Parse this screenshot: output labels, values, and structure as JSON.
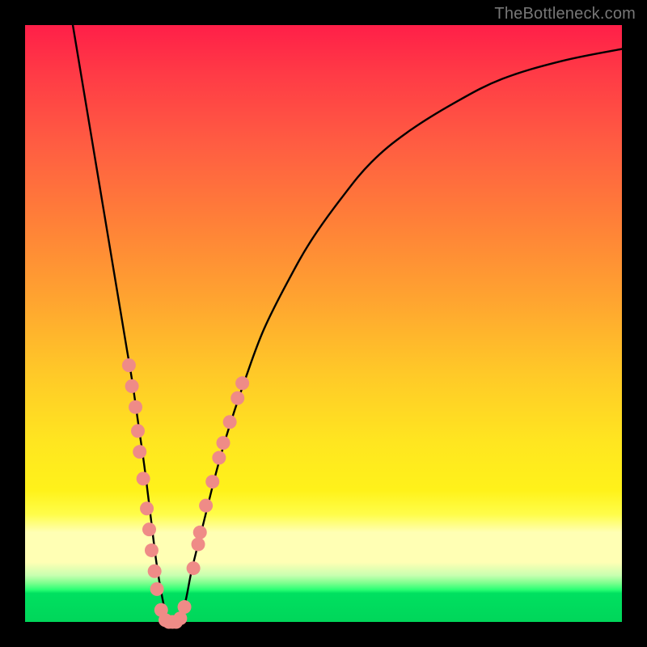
{
  "watermark": "TheBottleneck.com",
  "chart_data": {
    "type": "line",
    "title": "",
    "xlabel": "",
    "ylabel": "",
    "xlim": [
      0,
      100
    ],
    "ylim": [
      0,
      100
    ],
    "series": [
      {
        "name": "bottleneck-curve",
        "x": [
          8,
          10,
          12,
          14,
          16,
          17,
          18,
          19,
          20,
          21,
          22,
          23,
          24,
          25,
          26,
          27,
          28,
          30,
          32,
          34,
          37,
          40,
          44,
          48,
          53,
          58,
          64,
          72,
          80,
          90,
          100
        ],
        "y": [
          100,
          88,
          76,
          64,
          52,
          46,
          40,
          33,
          26,
          18,
          10,
          4,
          0,
          0,
          0,
          4,
          9,
          17,
          25,
          32,
          41,
          49,
          57,
          64,
          71,
          77,
          82,
          87,
          91,
          94,
          96
        ]
      }
    ],
    "markers": {
      "name": "highlight-dots",
      "color": "#ef8b87",
      "points": [
        {
          "x": 17.4,
          "y": 43.0
        },
        {
          "x": 17.9,
          "y": 39.5
        },
        {
          "x": 18.5,
          "y": 36.0
        },
        {
          "x": 18.9,
          "y": 32.0
        },
        {
          "x": 19.2,
          "y": 28.5
        },
        {
          "x": 19.8,
          "y": 24.0
        },
        {
          "x": 20.4,
          "y": 19.0
        },
        {
          "x": 20.8,
          "y": 15.5
        },
        {
          "x": 21.2,
          "y": 12.0
        },
        {
          "x": 21.7,
          "y": 8.5
        },
        {
          "x": 22.1,
          "y": 5.5
        },
        {
          "x": 22.8,
          "y": 2.0
        },
        {
          "x": 23.5,
          "y": 0.3
        },
        {
          "x": 24.1,
          "y": 0.0
        },
        {
          "x": 24.7,
          "y": 0.0
        },
        {
          "x": 25.3,
          "y": 0.0
        },
        {
          "x": 26.0,
          "y": 0.6
        },
        {
          "x": 26.7,
          "y": 2.5
        },
        {
          "x": 28.2,
          "y": 9.0
        },
        {
          "x": 29.0,
          "y": 13.0
        },
        {
          "x": 29.3,
          "y": 15.0
        },
        {
          "x": 30.3,
          "y": 19.5
        },
        {
          "x": 31.4,
          "y": 23.5
        },
        {
          "x": 32.5,
          "y": 27.5
        },
        {
          "x": 33.2,
          "y": 30.0
        },
        {
          "x": 34.3,
          "y": 33.5
        },
        {
          "x": 35.6,
          "y": 37.5
        },
        {
          "x": 36.4,
          "y": 40.0
        }
      ]
    }
  }
}
